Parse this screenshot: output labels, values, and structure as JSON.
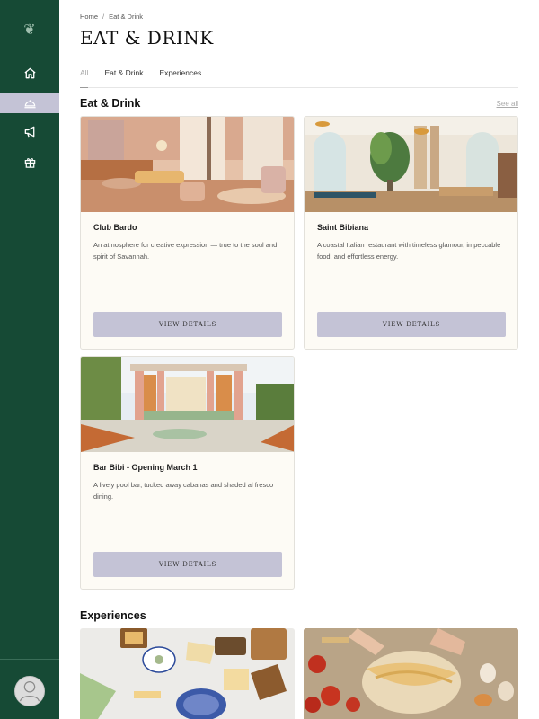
{
  "sidebar": {
    "logo_icon": "script-logo-icon",
    "items": [
      {
        "icon": "home-icon",
        "active": false
      },
      {
        "icon": "cloche-icon",
        "active": true
      },
      {
        "icon": "megaphone-icon",
        "active": false
      },
      {
        "icon": "gift-icon",
        "active": false
      }
    ],
    "avatar_icon": "user-avatar-icon",
    "colors": {
      "background": "#164a35",
      "active": "#c4c3d6"
    }
  },
  "breadcrumb": {
    "home": "Home",
    "separator": "/",
    "current": "Eat & Drink"
  },
  "page_title": "EAT & DRINK",
  "tabs": [
    {
      "label": "All",
      "active": true
    },
    {
      "label": "Eat & Drink",
      "active": false
    },
    {
      "label": "Experiences",
      "active": false
    }
  ],
  "eat_drink": {
    "title": "Eat & Drink",
    "see_all": "See all",
    "cards": [
      {
        "title": "Club Bardo",
        "description": "An atmosphere for creative expression — true to the soul and spirit of Savannah.",
        "button": "VIEW DETAILS"
      },
      {
        "title": "Saint Bibiana",
        "description": "A coastal Italian restaurant with timeless glamour, impeccable food, and effortless energy.",
        "button": "VIEW DETAILS"
      },
      {
        "title": "Bar Bibi - Opening March 1",
        "description": "A lively pool bar, tucked away cabanas and shaded al fresco dining.",
        "button": "VIEW DETAILS"
      }
    ]
  },
  "experiences": {
    "title": "Experiences"
  },
  "colors": {
    "card_background": "#fdfbf5",
    "button_background": "#c4c3d6"
  }
}
